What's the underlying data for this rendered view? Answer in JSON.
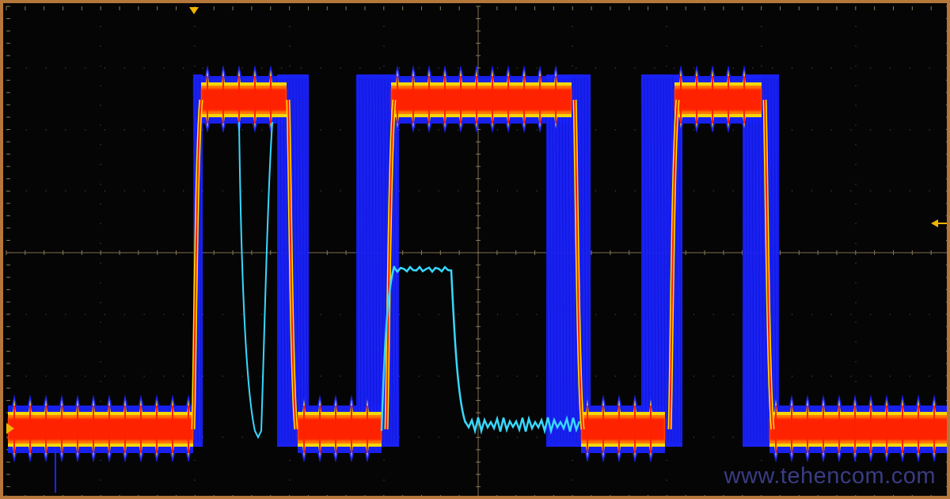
{
  "screen": {
    "background_color": "#000000",
    "frame_color": "#b5773a",
    "grid_color": "#8a7a5c"
  },
  "watermark": {
    "text": "www.tehencom.com",
    "color": "#3c3f8a"
  },
  "markers": {
    "trigger_position_icon": "down-triangle",
    "trigger_level_icon": "left-arrow",
    "channel_ground_icon": "right-triangle",
    "color": "#f0b400"
  },
  "waveform": {
    "display_mode": "color-graded persistence",
    "dominant_color": "#ff2000",
    "mid_color": "#ffe000",
    "rare_color": "#1a23ff",
    "single_event_color": "#38d8ff"
  }
}
